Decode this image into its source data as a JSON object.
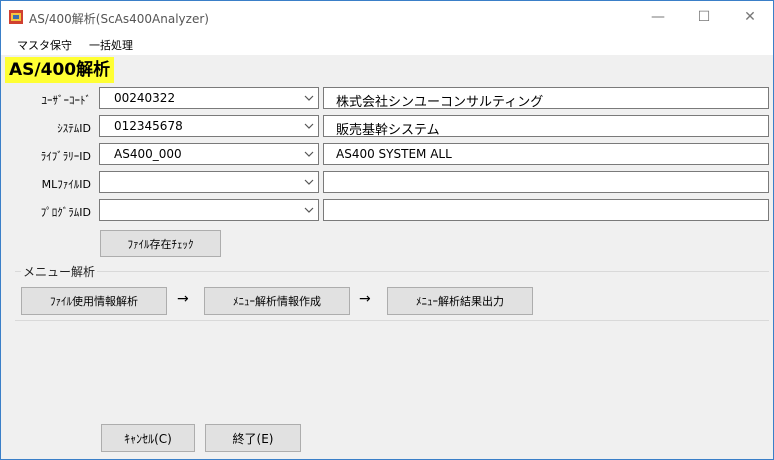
{
  "window": {
    "title": "AS/400解析(ScAs400Analyzer)",
    "minimize_glyph": "—",
    "maximize_glyph": "☐",
    "close_glyph": "✕"
  },
  "menu": {
    "items": [
      "マスタ保守",
      "一括処理"
    ]
  },
  "heading": "AS/400解析",
  "fields": [
    {
      "label": "ﾕｰｻﾞｰｺｰﾄﾞ",
      "value": "00240322",
      "description": "株式会社シンユーコンサルティング"
    },
    {
      "label": "ｼｽﾃﾑID",
      "value": "012345678",
      "description": "販売基幹システム"
    },
    {
      "label": "ﾗｲﾌﾞﾗﾘｰID",
      "value": "AS400_000",
      "description": "AS400 SYSTEM ALL"
    },
    {
      "label": "MLﾌｧｲﾙID",
      "value": "",
      "description": ""
    },
    {
      "label": "ﾌﾟﾛｸﾞﾗﾑID",
      "value": "",
      "description": ""
    }
  ],
  "file_check_button": "ﾌｧｲﾙ存在ﾁｪｯｸ",
  "menu_analysis": {
    "group_label": "メニュー解析",
    "steps": [
      "ﾌｧｲﾙ使用情報解析",
      "ﾒﾆｭｰ解析情報作成",
      "ﾒﾆｭｰ解析結果出力"
    ],
    "arrow": "→"
  },
  "footer": {
    "cancel": "ｷｬﾝｾﾙ(C)",
    "exit": "終了(E)"
  },
  "colors": {
    "heading_highlight": "#ffff33",
    "window_border": "#3a7fc8",
    "button_face": "#e1e1e1"
  }
}
